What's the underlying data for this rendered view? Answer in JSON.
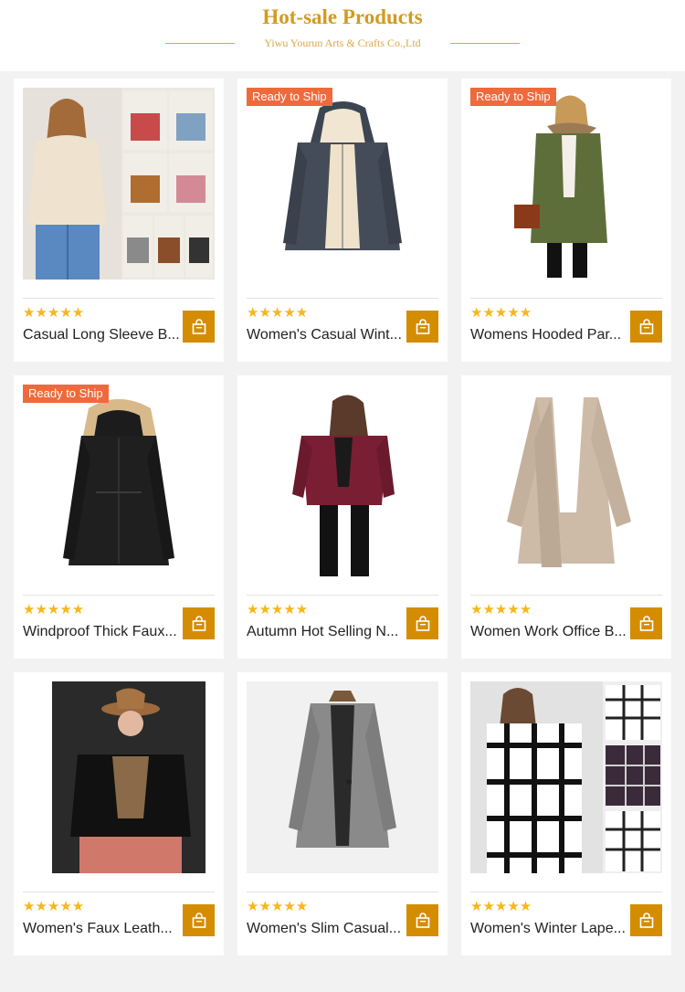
{
  "header": {
    "title": "Hot-sale Products",
    "subtitle": "Yiwu Yourun Arts & Crafts Co.,Ltd"
  },
  "colors": {
    "accent": "#d48d00",
    "badge": "#ee6a3d",
    "star": "#f5b71a"
  },
  "rating_text": "★★★★★",
  "products": [
    {
      "name": "Casual Long Sleeve B...",
      "badge": "",
      "image": "beige-corduroy-jacket-grid"
    },
    {
      "name": "Women's Casual Wint...",
      "badge": "Ready to Ship",
      "image": "grey-sherpa-hoodie"
    },
    {
      "name": "Womens Hooded Par...",
      "badge": "Ready to Ship",
      "image": "green-parka-fur-hood"
    },
    {
      "name": "Windproof Thick Faux...",
      "badge": "Ready to Ship",
      "image": "black-parka-fur-hood"
    },
    {
      "name": "Autumn Hot Selling N...",
      "badge": "",
      "image": "burgundy-leather-jacket"
    },
    {
      "name": "Women Work Office B...",
      "badge": "",
      "image": "beige-open-blazer"
    },
    {
      "name": "Women's Faux Leath...",
      "badge": "",
      "image": "black-leather-jacket-hat"
    },
    {
      "name": "Women's Slim Casual...",
      "badge": "",
      "image": "grey-tweed-coat"
    },
    {
      "name": "Women's Winter Lape...",
      "badge": "",
      "image": "plaid-lapel-coat"
    }
  ]
}
